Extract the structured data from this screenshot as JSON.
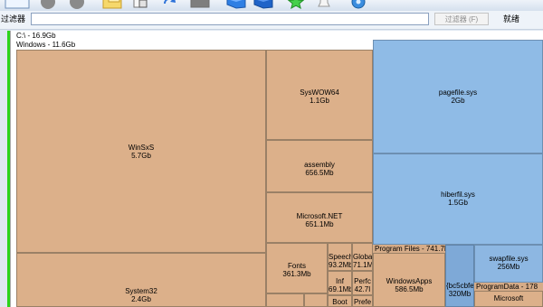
{
  "toolbar": {
    "buttons": [
      {
        "name": "window-icon"
      },
      {
        "name": "scan-icon"
      },
      {
        "name": "stop-icon"
      },
      {
        "name": "folder-open-icon"
      },
      {
        "name": "copy-icon"
      },
      {
        "name": "refresh-icon"
      },
      {
        "name": "grey-square-icon"
      },
      {
        "name": "cube-icon"
      },
      {
        "name": "cube-dark-icon"
      },
      {
        "name": "star-icon"
      },
      {
        "name": "bell-icon"
      },
      {
        "name": "settings-gear-icon"
      }
    ]
  },
  "filter": {
    "label": "过滤器",
    "input_value": "",
    "button": "过滤器 (F)",
    "ready": "就绪"
  },
  "paths": {
    "drive": "C:\\ - 16.9Gb",
    "windows": "Windows - 11.6Gb"
  },
  "tiles": {
    "winsxs": {
      "name": "WinSxS",
      "size": "5.7Gb"
    },
    "system32": {
      "name": "System32",
      "size": "2.4Gb"
    },
    "syswow64": {
      "name": "SysWOW64",
      "size": "1.1Gb"
    },
    "assembly": {
      "name": "assembly",
      "size": "656.5Mb"
    },
    "microsoft_net": {
      "name": "Microsoft.NET",
      "size": "651.1Mb"
    },
    "fonts": {
      "name": "Fonts",
      "size": "361.3Mb"
    },
    "speech": {
      "name": "Speech",
      "size": "93.2Mb"
    },
    "globa": {
      "name": "Globa",
      "size": "71.1M"
    },
    "inf": {
      "name": "Inf",
      "size": "69.1Mb"
    },
    "perfc": {
      "name": "Perfc",
      "size": "42.7I"
    },
    "boot": {
      "name": "Boot"
    },
    "prefe": {
      "name": "Prefe"
    },
    "pagefile": {
      "name": "pagefile.sys",
      "size": "2Gb"
    },
    "hiberfil": {
      "name": "hiberfil.sys",
      "size": "1.5Gb"
    },
    "program_files": {
      "header": "Program Files - 741.7M"
    },
    "windowsapps": {
      "name": "WindowsApps",
      "size": "586.5Mb"
    },
    "bc5cbfe": {
      "name": "{bc5cbfe",
      "size": "320Mb"
    },
    "swapfile": {
      "name": "swapfile.sys",
      "size": "256Mb"
    },
    "programdata": {
      "header": "ProgramData - 178"
    },
    "microsoft": {
      "name": "Microsoft"
    }
  }
}
